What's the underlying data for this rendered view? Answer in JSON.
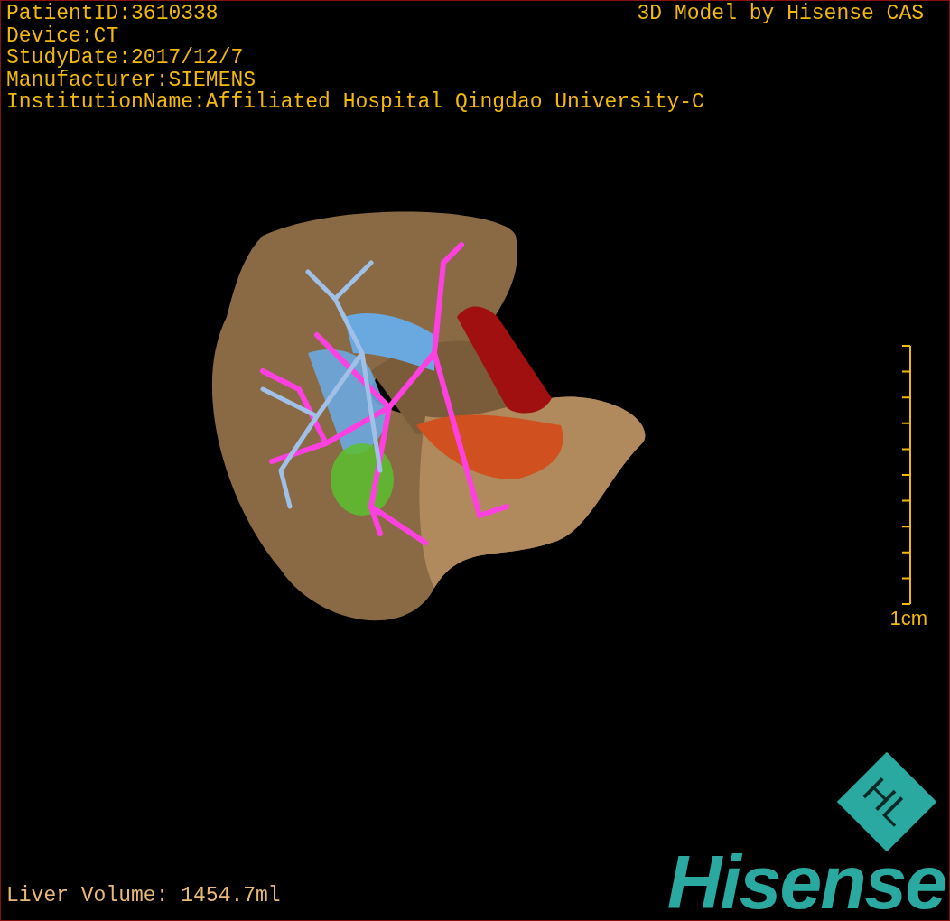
{
  "header": {
    "info_lines": [
      "PatientID:3610338",
      "Device:CT",
      "StudyDate:2017/12/7",
      "Manufacturer:SIEMENS",
      "InstitutionName:Affiliated Hospital Qingdao University-C"
    ],
    "credit": "3D Model by Hisense CAS"
  },
  "scale_bar": {
    "label": "1cm"
  },
  "footer": {
    "volume": "Liver Volume: 1454.7ml"
  },
  "logo": {
    "badge": "HL",
    "wordmark": "Hisense"
  }
}
